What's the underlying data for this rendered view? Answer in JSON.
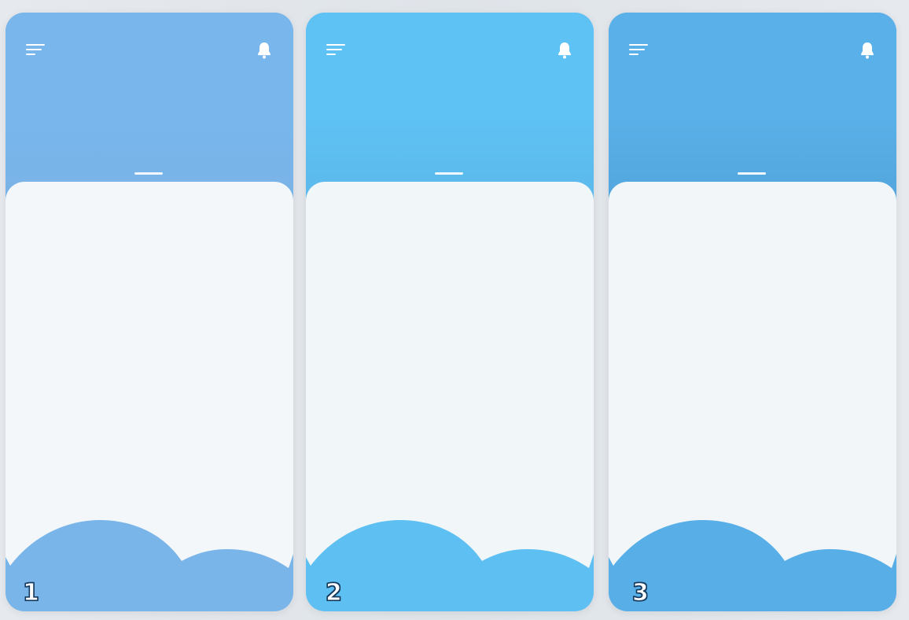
{
  "screens": [
    {
      "number": "1",
      "colors": {
        "header_top": "#78b6ec",
        "header_bottom": "#7ab3e6",
        "card": "#f4f7fa",
        "wave": "#7ab5ea"
      },
      "icons": {
        "menu": "menu-icon",
        "notification": "bell-icon"
      }
    },
    {
      "number": "2",
      "colors": {
        "header_top": "#5fc2f4",
        "header_bottom": "#5bb8ea",
        "card": "#f1f6f9",
        "wave": "#5ec0f2"
      },
      "icons": {
        "menu": "menu-icon",
        "notification": "bell-icon"
      }
    },
    {
      "number": "3",
      "colors": {
        "header_top": "#5ab0e8",
        "header_bottom": "#52a6dd",
        "card": "#f2f6f9",
        "wave": "#58afe8"
      },
      "icons": {
        "menu": "menu-icon",
        "notification": "bell-icon"
      }
    }
  ]
}
